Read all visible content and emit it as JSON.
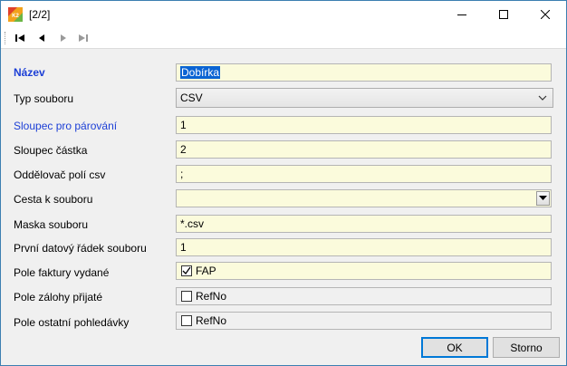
{
  "window": {
    "title": "[2/2]",
    "app_icon": "k2-app-icon"
  },
  "toolbar": {
    "buttons": [
      "first-record-icon",
      "previous-record-icon",
      "next-record-icon",
      "last-record-icon"
    ]
  },
  "form": {
    "nazev": {
      "label": "Název",
      "value": "Dobírka"
    },
    "typ_souboru": {
      "label": "Typ souboru",
      "value": "CSV"
    },
    "sloupec_parovani": {
      "label": "Sloupec pro párování",
      "value": "1"
    },
    "sloupec_castka": {
      "label": "Sloupec částka",
      "value": "2"
    },
    "oddelovac": {
      "label": "Oddělovač polí csv",
      "value": ";"
    },
    "cesta": {
      "label": "Cesta k souboru",
      "value": ""
    },
    "maska": {
      "label": "Maska souboru",
      "value": "*.csv"
    },
    "prvni_radek": {
      "label": "První datový řádek souboru",
      "value": "1"
    },
    "pole_faktury": {
      "label": "Pole faktury vydané",
      "value": "FAP",
      "checked": true
    },
    "pole_zalohy": {
      "label": "Pole zálohy přijaté",
      "value": "RefNo",
      "checked": false
    },
    "pole_ostatni": {
      "label": "Pole ostatní pohledávky",
      "value": "RefNo",
      "checked": false
    }
  },
  "buttons": {
    "ok": "OK",
    "cancel": "Storno"
  },
  "colors": {
    "accent_label": "#1c3fd6",
    "field_bg": "#fbfbdc",
    "selection": "#0a64d3"
  }
}
